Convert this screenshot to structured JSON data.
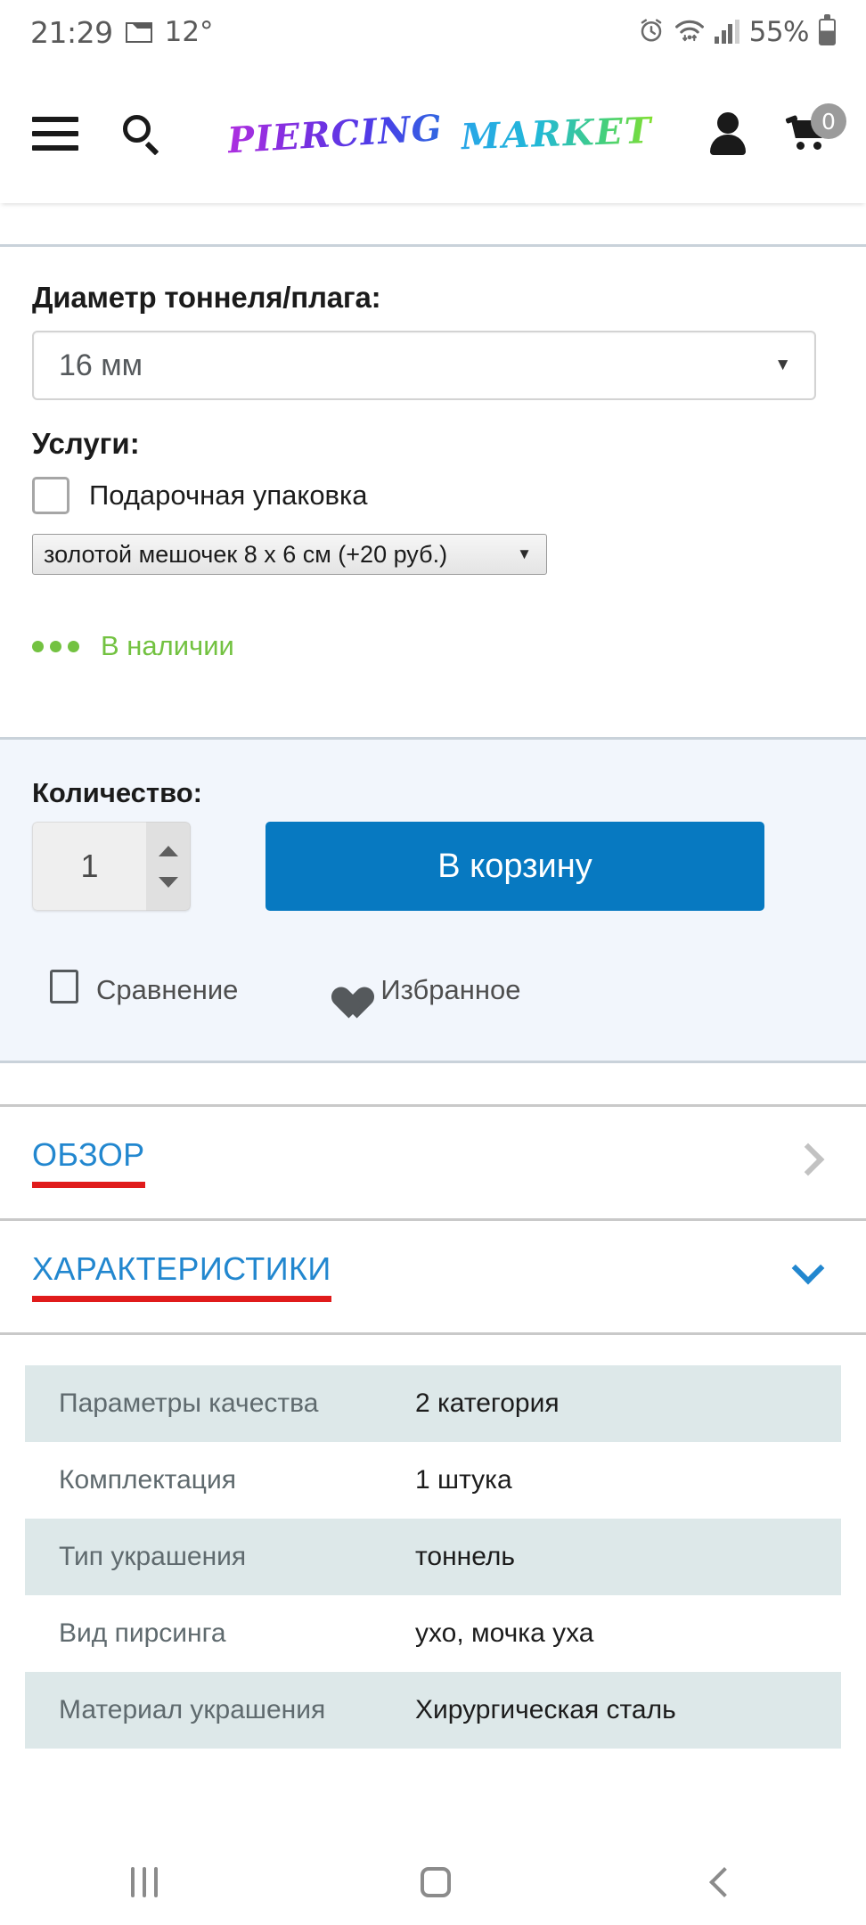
{
  "status_bar": {
    "time": "21:29",
    "temperature": "12°",
    "battery_percent": "55%",
    "icons": [
      "mail-icon",
      "alarm-icon",
      "wifi-icon",
      "signal-icon",
      "battery-icon"
    ]
  },
  "header": {
    "logo_line1": "PIERCING",
    "logo_line2": "MARKET",
    "cart_count": "0",
    "icons": [
      "hamburger-menu-icon",
      "search-icon",
      "account-icon",
      "cart-icon"
    ]
  },
  "options": {
    "diameter_label": "Диаметр тоннеля/плага:",
    "diameter_value": "16 мм",
    "services_label": "Услуги:",
    "gift_wrap_label": "Подарочная упаковка",
    "gift_wrap_checked": false,
    "wrap_option_value": "золотой мешочек 8 x 6 см (+20 руб.)",
    "stock_status": "В наличии",
    "stock_color": "#73c241",
    "caret": "▼"
  },
  "buy_block": {
    "quantity_label": "Количество:",
    "quantity_value": "1",
    "add_to_cart_label": "В корзину",
    "add_to_cart_color": "#0779c1",
    "compare_label": "Сравнение",
    "favorite_label": "Избранное",
    "background_color": "#f2f6fc"
  },
  "accordion": [
    {
      "title": "ОБЗОР",
      "expanded": false,
      "chevron": "chevron-right-icon"
    },
    {
      "title": "ХАРАКТЕРИСТИКИ",
      "expanded": true,
      "chevron": "chevron-down-icon"
    }
  ],
  "accent_colors": {
    "link_blue": "#2287cf",
    "underline_red": "#e01b1b"
  },
  "specs": [
    {
      "key": "Параметры качества",
      "value": "2 категория"
    },
    {
      "key": "Комплектация",
      "value": "1 штука"
    },
    {
      "key": "Тип украшения",
      "value": "тоннель"
    },
    {
      "key": "Вид пирсинга",
      "value": "ухо, мочка уха"
    },
    {
      "key": "Материал украшения",
      "value": "Хирургическая сталь"
    }
  ],
  "navbar": {
    "recents": "recents-icon",
    "home": "home-icon",
    "back": "back-icon"
  }
}
